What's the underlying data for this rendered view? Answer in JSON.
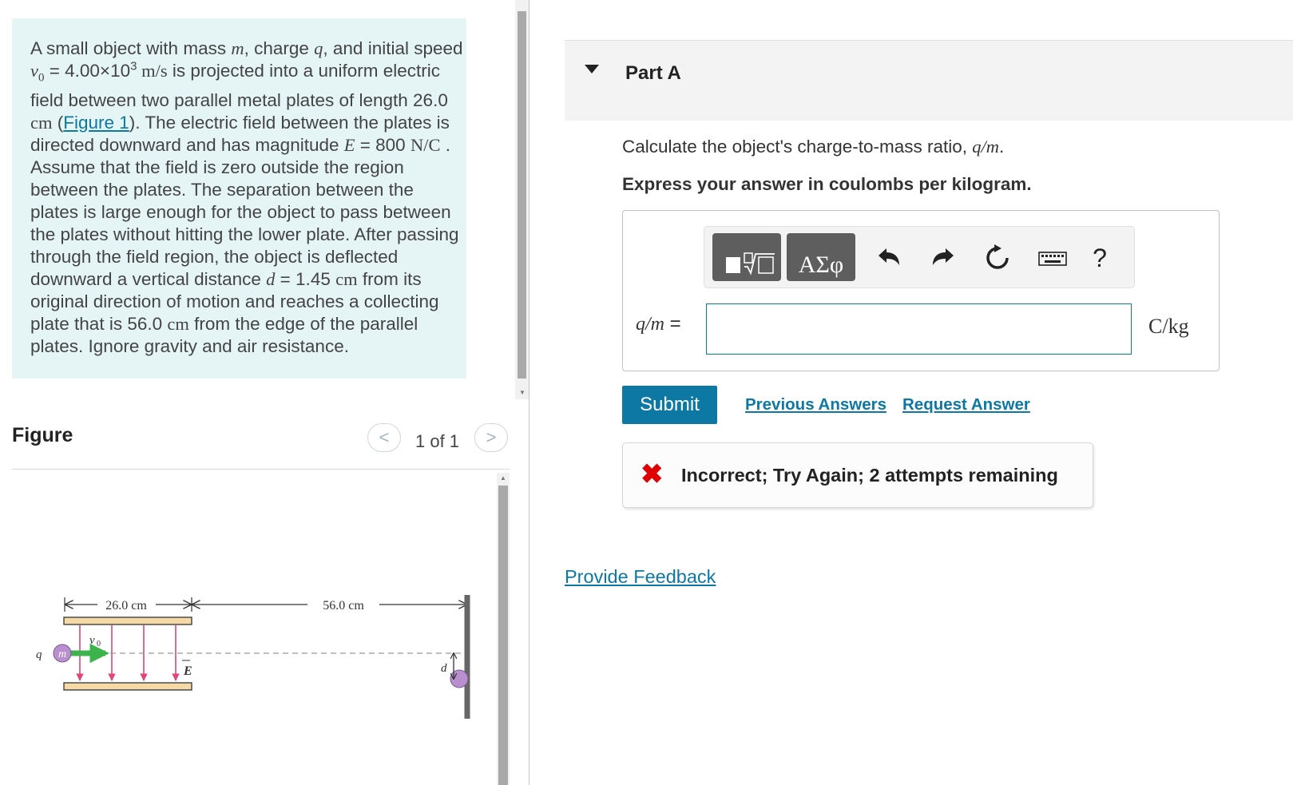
{
  "problem": {
    "t1": "A small object with mass ",
    "m": "m",
    "t2": ", charge ",
    "q": "q",
    "t3": ", and initial speed",
    "v0": "v",
    "v0_sub": "0",
    "t4": " = 4.00×10",
    "exp": "3",
    "speed_unit": " m/s",
    "t5": " is projected into a uniform electric field between two parallel metal plates of length 26.0 ",
    "cm1": "cm",
    "t6": " (",
    "figure_link": "Figure 1",
    "t7": "). The electric field between the plates is directed downward and has magnitude ",
    "E": "E",
    "t8": " = 800 ",
    "field_unit": "N/C",
    "t9": " . Assume that the field is zero outside the region between the plates. The separation between the plates is large enough for the object to pass between the plates without hitting the lower plate. After passing through the field region, the object is deflected downward a vertical distance ",
    "d": "d",
    "t10": " = 1.45 ",
    "cm2": "cm",
    "t11": " from its original direction of motion and reaches a collecting plate that is 56.0 ",
    "cm3": "cm",
    "t12": " from the edge of the parallel plates. Ignore gravity and air resistance."
  },
  "figure": {
    "title": "Figure",
    "prev": "<",
    "next": ">",
    "counter": "1 of 1",
    "label_length": "26.0 cm",
    "label_distance": "56.0 cm",
    "label_q": "q",
    "label_m": "m",
    "label_v0": "v",
    "label_v0_sub": "0",
    "label_E": "E",
    "label_d": "d"
  },
  "part": {
    "title": "Part A",
    "question_text": "Calculate the object's charge-to-mass ratio, ",
    "question_math": "q/m",
    "question_end": ".",
    "instruction": "Express your answer in coulombs per kilogram."
  },
  "toolbar": {
    "templates_icon": "templates-icon",
    "symbols_label": "ΑΣφ",
    "undo_icon": "undo-icon",
    "redo_icon": "redo-icon",
    "reset_icon": "reset-icon",
    "keyboard_icon": "keyboard-icon",
    "help_label": "?"
  },
  "answer": {
    "label_math": "q/m",
    "label_eq": " =",
    "value": "",
    "unit": "C/kg"
  },
  "actions": {
    "submit": "Submit",
    "previous_answers": "Previous Answers",
    "request_answer": "Request Answer"
  },
  "feedback": {
    "icon": "✖",
    "text": "Incorrect; Try Again; 2 attempts remaining"
  },
  "provide_feedback": "Provide Feedback",
  "colors": {
    "accent": "#0c78a3",
    "problem_bg": "#e5f5f5",
    "error": "#e00000",
    "plate": "#f5d9a6",
    "field_arrow": "#e0457b",
    "velocity_arrow": "#3cb44b",
    "particle": "#b98fd0"
  }
}
